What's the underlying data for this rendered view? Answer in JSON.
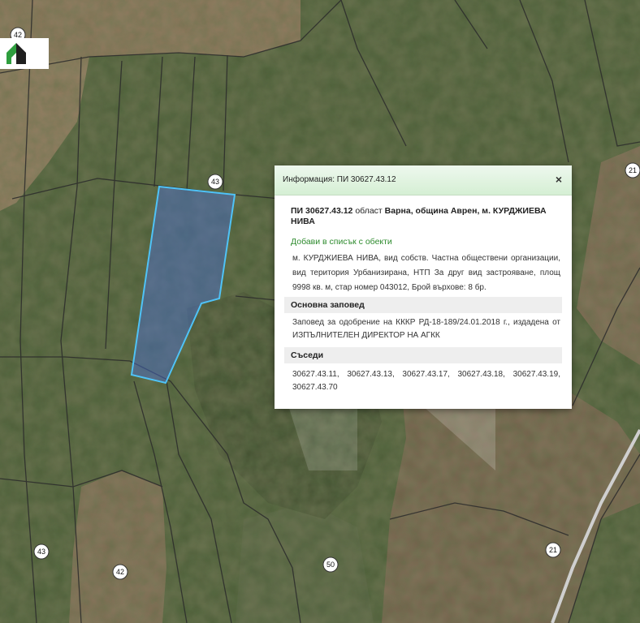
{
  "map": {
    "parcel_numbers": [
      "42",
      "43",
      "43",
      "42",
      "50",
      "21",
      "21"
    ],
    "colors": {
      "parcel_outline": "#4fc3f7",
      "parcel_fill": "#4a6fd6",
      "map_lines": "#3a3a3a"
    }
  },
  "logo": {
    "icon": "house-logo-icon"
  },
  "popup": {
    "title": "Информация: ПИ 30627.43.12",
    "close_label": "×",
    "heading_part1": "ПИ 30627.43.12",
    "heading_part2": "област",
    "heading_part3": "Варна, община Аврен, м. КУРДЖИЕВА НИВА",
    "add_link": "Добави в списък с обекти",
    "description": "м. КУРДЖИЕВА НИВА, вид собств. Частна обществени организации, вид територия Урбанизирана, НТП За друг вид застрояване, площ 9998 кв. м, стар номер 043012, Брой върхове: 8 бр.",
    "order_section": "Основна заповед",
    "order_text": "Заповед за одобрение на КККР РД-18-189/24.01.2018 г., издадена от ИЗПЪЛНИТЕЛЕН ДИРЕКТОР НА АГКК",
    "neighbors_section": "Съседи",
    "neighbors": [
      "30627.43.11,",
      "30627.43.13,",
      "30627.43.17,",
      "30627.43.18,",
      "30627.43.19,",
      "30627.43.70"
    ]
  }
}
